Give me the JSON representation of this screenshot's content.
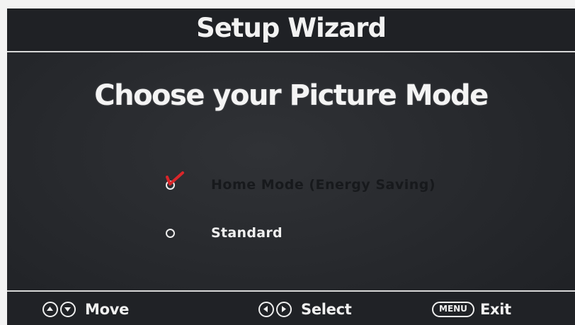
{
  "header": {
    "title": "Setup Wizard"
  },
  "main": {
    "title": "Choose your Picture Mode",
    "options": [
      {
        "label": "Home Mode (Energy Saving)",
        "selected": true,
        "icon": "checkmark-icon"
      },
      {
        "label": "Standard",
        "selected": false,
        "icon": "radio-icon"
      }
    ]
  },
  "footer": {
    "hints": [
      {
        "icons": [
          "up-arrow-icon",
          "down-arrow-icon"
        ],
        "label": "Move"
      },
      {
        "icons": [
          "left-arrow-icon",
          "right-arrow-icon"
        ],
        "label": "Select"
      },
      {
        "key": "MENU",
        "label": "Exit"
      }
    ]
  },
  "colors": {
    "screen_bg": "#26282c",
    "text": "#f2f2f2",
    "highlighted_text": "#17191c",
    "check_accent": "#d9262a"
  }
}
